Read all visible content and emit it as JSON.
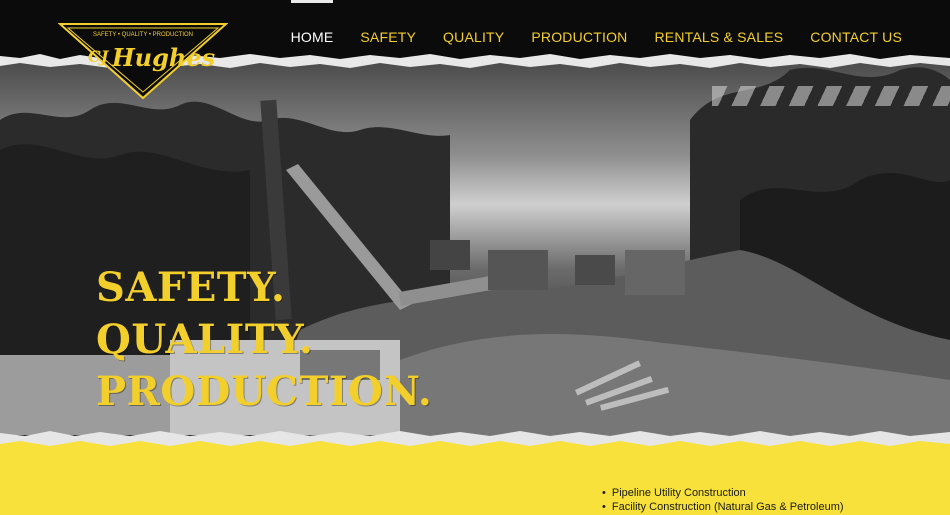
{
  "logo": {
    "tagline": "SAFETY • QUALITY • PRODUCTION",
    "initials": "CJ",
    "name": "Hughes"
  },
  "nav": {
    "items": [
      {
        "label": "HOME",
        "active": true
      },
      {
        "label": "SAFETY",
        "active": false
      },
      {
        "label": "QUALITY",
        "active": false
      },
      {
        "label": "PRODUCTION",
        "active": false
      },
      {
        "label": "RENTALS & SALES",
        "active": false
      },
      {
        "label": "CONTACT US",
        "active": false
      }
    ]
  },
  "hero": {
    "line1": "SAFETY.",
    "line2": "QUALITY.",
    "line3": "PRODUCTION."
  },
  "services": {
    "items": [
      "Pipeline Utility Construction",
      "Facility Construction (Natural Gas & Petroleum)"
    ]
  },
  "colors": {
    "accent": "#f3cf2b",
    "band": "#f7e13a",
    "nav_bg": "#0b0b0b"
  }
}
